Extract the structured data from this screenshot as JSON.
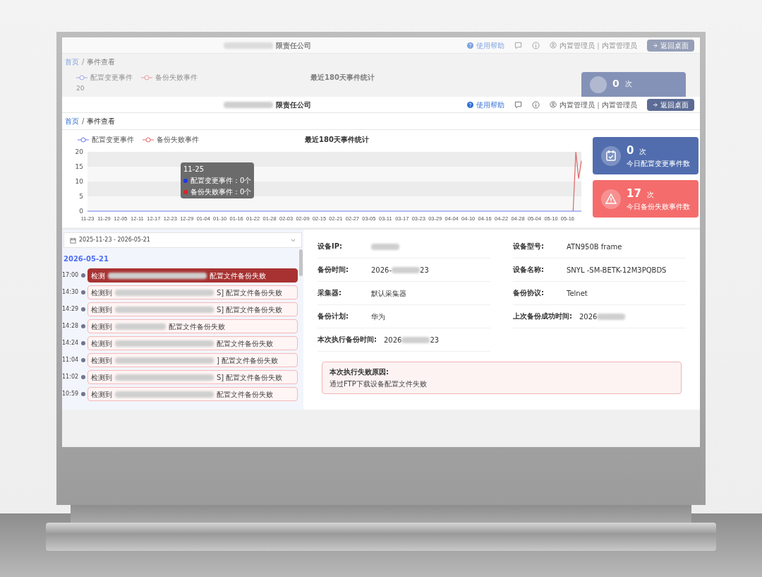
{
  "ghost": {
    "company": "限责任公司",
    "help": "使用帮助",
    "user": "内置管理员｜内置管理员",
    "return_button": "返回桌面",
    "breadcrumb": [
      "首页",
      "/",
      "事件查看"
    ],
    "chart_title": "最近180天事件统计",
    "legend": [
      "配置变更事件",
      "备份失败事件"
    ],
    "y_tick": "20",
    "card_value": "0",
    "card_unit": "次"
  },
  "header": {
    "company": "限责任公司",
    "help": "使用帮助",
    "user": "内置管理员｜内置管理员",
    "return_button": "返回桌面"
  },
  "breadcrumb": [
    {
      "label": "首页",
      "kind": "link"
    },
    {
      "label": "/",
      "kind": "separator"
    },
    {
      "label": "事件查看",
      "kind": "current"
    }
  ],
  "chart": {
    "chart_data": {
      "type": "line",
      "title": "最近180天事件统计",
      "categories": [
        "11-23",
        null,
        null,
        null,
        null,
        null,
        "11-29",
        null,
        null,
        null,
        null,
        null,
        "12-05",
        null,
        null,
        null,
        null,
        null,
        "12-11",
        null,
        null,
        null,
        null,
        null,
        "12-17",
        null,
        null,
        null,
        null,
        null,
        "12-23",
        null,
        null,
        null,
        null,
        null,
        "12-29",
        null,
        null,
        null,
        null,
        null,
        "01-04",
        null,
        null,
        null,
        null,
        null,
        "01-10",
        null,
        null,
        null,
        null,
        null,
        "01-16",
        null,
        null,
        null,
        null,
        null,
        "01-22",
        null,
        null,
        null,
        null,
        null,
        "01-28",
        null,
        null,
        null,
        null,
        null,
        "02-03",
        null,
        null,
        null,
        null,
        null,
        "02-09",
        null,
        null,
        null,
        null,
        null,
        "02-15",
        null,
        null,
        null,
        null,
        null,
        "02-21",
        null,
        null,
        null,
        null,
        null,
        "02-27",
        null,
        null,
        null,
        null,
        null,
        "03-05",
        null,
        null,
        null,
        null,
        null,
        "03-11",
        null,
        null,
        null,
        null,
        null,
        "03-17",
        null,
        null,
        null,
        null,
        null,
        "03-23",
        null,
        null,
        null,
        null,
        null,
        "03-29",
        null,
        null,
        null,
        null,
        null,
        "04-04",
        null,
        null,
        null,
        null,
        null,
        "04-10",
        null,
        null,
        null,
        null,
        null,
        "04-16",
        null,
        null,
        null,
        null,
        null,
        "04-22",
        null,
        null,
        null,
        null,
        null,
        "04-28",
        null,
        null,
        null,
        null,
        null,
        "05-04",
        null,
        null,
        null,
        null,
        null,
        "05-10",
        null,
        null,
        null,
        null,
        null,
        "05-16",
        null,
        null,
        null,
        null,
        null
      ],
      "yticks": [
        0,
        5,
        10,
        15,
        20
      ],
      "ylim": [
        0,
        20
      ],
      "series": [
        {
          "name": "配置变更事件",
          "color": "#6b7bf0",
          "values": [
            0,
            0,
            0,
            0,
            0,
            0,
            0,
            0,
            0,
            0,
            0,
            0,
            0,
            0,
            0,
            0,
            0,
            0,
            0,
            0,
            0,
            0,
            0,
            0,
            0,
            0,
            0,
            0,
            0,
            0,
            0,
            0,
            0,
            0,
            0,
            0,
            0,
            0,
            0,
            0,
            0,
            0,
            0,
            0,
            0,
            0,
            0,
            0,
            0,
            0,
            0,
            0,
            0,
            0,
            0,
            0,
            0,
            0,
            0,
            0,
            0,
            0,
            0,
            0,
            0,
            0,
            0,
            0,
            0,
            0,
            0,
            0,
            0,
            0,
            0,
            0,
            0,
            0,
            0,
            0,
            0,
            0,
            0,
            0,
            0,
            0,
            0,
            0,
            0,
            0,
            0,
            0,
            0,
            0,
            0,
            0,
            0,
            0,
            0,
            0,
            0,
            0,
            0,
            0,
            0,
            0,
            0,
            0,
            0,
            0,
            0,
            0,
            0,
            0,
            0,
            0,
            0,
            0,
            0,
            0,
            0,
            0,
            0,
            0,
            0,
            0,
            0,
            0,
            0,
            0,
            0,
            0,
            0,
            0,
            0,
            0,
            0,
            0,
            0,
            0,
            0,
            0,
            0,
            0,
            0,
            0,
            0,
            0,
            0,
            0,
            0,
            0,
            0,
            0,
            0,
            0,
            0,
            0,
            0,
            0,
            0,
            0,
            0,
            0,
            0,
            0,
            0,
            0,
            0,
            0,
            0,
            0,
            0,
            0,
            0,
            0,
            0,
            0,
            0,
            0
          ]
        },
        {
          "name": "备份失败事件",
          "color": "#e06666",
          "values": [
            null,
            null,
            null,
            null,
            null,
            null,
            null,
            null,
            null,
            null,
            null,
            null,
            null,
            null,
            null,
            null,
            null,
            null,
            null,
            null,
            null,
            null,
            null,
            null,
            null,
            null,
            null,
            null,
            null,
            null,
            null,
            null,
            null,
            null,
            null,
            null,
            null,
            null,
            null,
            null,
            null,
            null,
            null,
            null,
            null,
            null,
            null,
            null,
            null,
            null,
            null,
            null,
            null,
            null,
            null,
            null,
            null,
            null,
            null,
            null,
            null,
            null,
            null,
            null,
            null,
            null,
            null,
            null,
            null,
            null,
            null,
            null,
            null,
            null,
            null,
            null,
            null,
            null,
            null,
            null,
            null,
            null,
            null,
            null,
            null,
            null,
            null,
            null,
            null,
            null,
            null,
            null,
            null,
            null,
            null,
            null,
            null,
            null,
            null,
            null,
            null,
            null,
            null,
            null,
            null,
            null,
            null,
            null,
            null,
            null,
            null,
            null,
            null,
            null,
            null,
            null,
            null,
            null,
            null,
            null,
            null,
            null,
            null,
            null,
            null,
            null,
            null,
            null,
            null,
            null,
            null,
            null,
            null,
            null,
            null,
            null,
            null,
            null,
            null,
            null,
            null,
            null,
            null,
            null,
            null,
            null,
            null,
            null,
            null,
            null,
            null,
            null,
            null,
            null,
            null,
            null,
            null,
            null,
            null,
            null,
            null,
            null,
            null,
            null,
            null,
            null,
            null,
            null,
            null,
            null,
            null,
            null,
            null,
            null,
            null,
            null,
            0,
            20,
            11,
            17
          ]
        }
      ]
    },
    "tooltip": {
      "title": "11-25",
      "rows": [
        {
          "text": "配置变更事件：0个",
          "color": "#2233ee"
        },
        {
          "text": "备份失败事件：0个",
          "color": "#dd2222"
        }
      ]
    }
  },
  "cards": [
    {
      "kind": "change",
      "value": "0",
      "unit": "次",
      "label": "今日配置变更事件数",
      "color": "#516dae"
    },
    {
      "kind": "failure",
      "value": "17",
      "unit": "次",
      "label": "今日备份失败事件数",
      "color": "#f56c6c"
    }
  ],
  "date_range": "2025-11-23 - 2026-05-21",
  "date_heading": "2026-05-21",
  "events": [
    {
      "time": "17:00",
      "prefix": "检测",
      "suffix": "配置文件备份失败",
      "selected": true
    },
    {
      "time": "14:30",
      "prefix": "检测到",
      "suffix": "S] 配置文件备份失败",
      "selected": false
    },
    {
      "time": "14:29",
      "prefix": "检测到",
      "suffix": "S] 配置文件备份失败",
      "selected": false
    },
    {
      "time": "14:28",
      "prefix": "检测到",
      "suffix": "配置文件备份失败",
      "selected": false
    },
    {
      "time": "14:24",
      "prefix": "检测到",
      "suffix": "配置文件备份失败",
      "selected": false
    },
    {
      "time": "11:04",
      "prefix": "检测到",
      "suffix": "] 配置文件备份失败",
      "selected": false
    },
    {
      "time": "11:02",
      "prefix": "检测到",
      "suffix": "S] 配置文件备份失败",
      "selected": false
    },
    {
      "time": "10:59",
      "prefix": "检测到",
      "suffix": "配置文件备份失败",
      "selected": false
    }
  ],
  "details": [
    {
      "label": "设备IP:",
      "redacted": true
    },
    {
      "label": "设备型号:",
      "value_start": "ATN950B frame",
      "redacted": false
    },
    {
      "label": "备份时间:",
      "value_start": "2026-",
      "redacted": true,
      "value_end": "23"
    },
    {
      "label": "设备名称:",
      "value_start": "SNYL -SM-BETK-12M3PQBDS",
      "redacted": false
    },
    {
      "label": "采集器:",
      "value_start": "默认采集器",
      "redacted": false
    },
    {
      "label": "备份协议:",
      "value_start": "Telnet",
      "redacted": false
    },
    {
      "label": "备份计划:",
      "value_start": "华为",
      "redacted": false
    },
    {
      "label": "上次备份成功时间:",
      "value_start": "2026",
      "redacted": true
    },
    {
      "label": "本次执行备份时间:",
      "value_start": "2026",
      "redacted": true,
      "value_end": "23"
    }
  ],
  "failure": {
    "title": "本次执行失败原因:",
    "reason": "通过FTP下载设备配置文件失败"
  }
}
